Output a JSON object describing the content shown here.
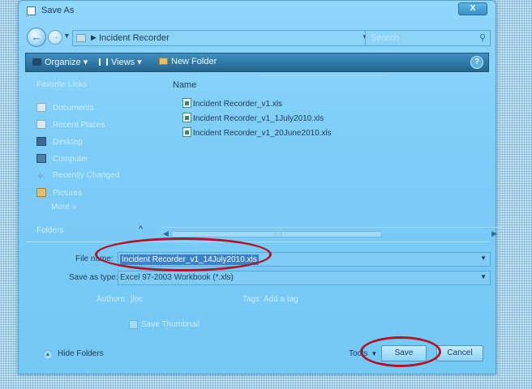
{
  "window": {
    "title": "Save As",
    "close_label": "X"
  },
  "nav": {
    "back_icon": "back-arrow-icon",
    "forward_icon": "forward-arrow-icon",
    "address_path": "Incident Recorder",
    "search_placeholder": "Search"
  },
  "toolbar": {
    "organize_label": "Organize",
    "views_label": "Views",
    "new_folder_label": "New Folder"
  },
  "sidebar": {
    "heading": "Favorite Links",
    "items": [
      {
        "label": "Documents",
        "icon": "documents-icon"
      },
      {
        "label": "Recent Places",
        "icon": "recent-places-icon"
      },
      {
        "label": "Desktop",
        "icon": "desktop-icon"
      },
      {
        "label": "Computer",
        "icon": "computer-icon"
      },
      {
        "label": "Recently Changed",
        "icon": "recently-changed-icon"
      },
      {
        "label": "Pictures",
        "icon": "pictures-icon"
      },
      {
        "label": "More »",
        "icon": ""
      }
    ],
    "folders_label": "Folders"
  },
  "filelist": {
    "column_name": "Name",
    "files": [
      "Incident Recorder_v1.xls",
      "Incident Recorder_v1_1July2010.xls",
      "Incident Recorder_v1_20June2010.xls"
    ]
  },
  "form": {
    "filename_label": "File name:",
    "filename_value": "Incident Recorder_v1_14July2010.xls",
    "savetype_label": "Save as type:",
    "savetype_value": "Excel 97-2003 Workbook (*.xls)",
    "authors_label": "Authors:",
    "authors_value": "jloc",
    "tags_label": "Tags:",
    "tags_value": "Add a tag",
    "thumbnail_label": "Save Thumbnail"
  },
  "footer": {
    "hide_folders_label": "Hide Folders",
    "tools_label": "Tools",
    "save_label": "Save",
    "cancel_label": "Cancel"
  },
  "colors": {
    "dialog_bg": "#7ccdf7",
    "toolbar_bg": "#2f7aa8",
    "annotation": "#b0142a",
    "selection": "#3b82c8"
  }
}
